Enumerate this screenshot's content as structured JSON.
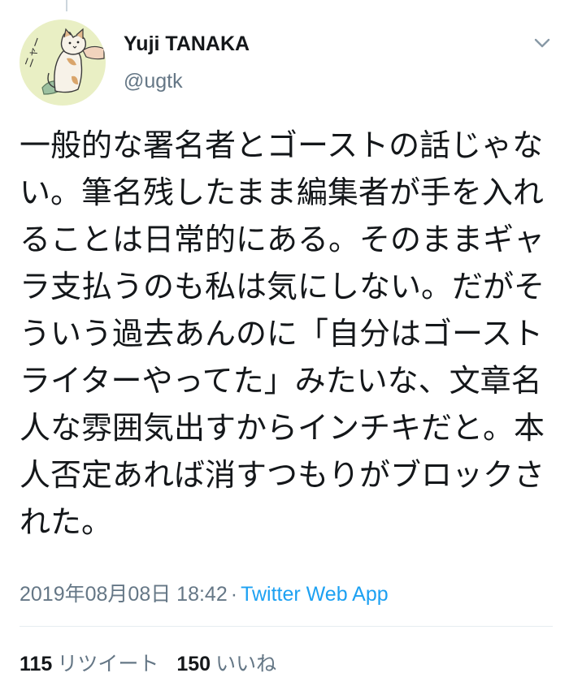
{
  "tweet": {
    "author_name": "Yuji TANAKA",
    "author_handle": "@ugtk",
    "avatar_text": "ニャー",
    "text": "一般的な署名者とゴーストの話じゃない。筆名残したまま編集者が手を入れることは日常的にある。そのままギャラ支払うのも私は気にしない。だがそういう過去あんのに「自分はゴーストライターやってた」みたいな、文章名人な雰囲気出すからインチキだと。本人否定あれば消すつもりがブロックされた。",
    "timestamp": "2019年08月08日 18:42",
    "separator": "·",
    "source": "Twitter Web App",
    "retweets": {
      "count": "115",
      "label": "リツイート"
    },
    "likes": {
      "count": "150",
      "label": "いいね"
    }
  },
  "icons": {
    "menu": "chevron-down-icon",
    "avatar": "cat-illustration-avatar"
  },
  "colors": {
    "link": "#1da1f2",
    "secondary_text": "#657786",
    "primary_text": "#14171a",
    "divider": "#e6ecf0"
  }
}
